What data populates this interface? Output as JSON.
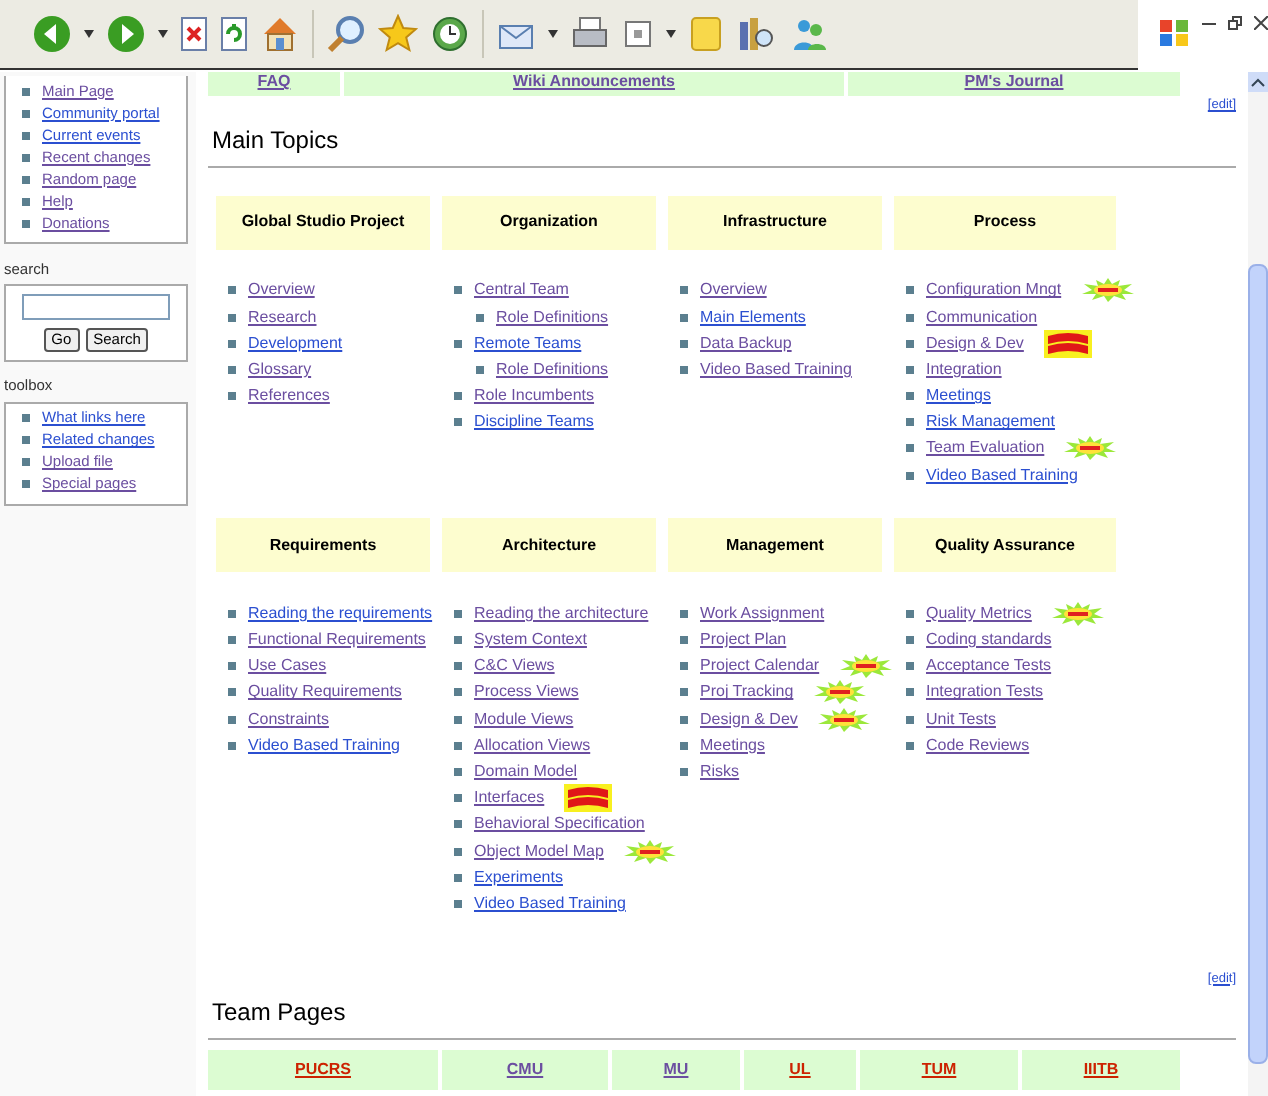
{
  "nav_links": [
    {
      "label": "FAQ",
      "visited": true
    },
    {
      "label": "Wiki Announcements",
      "visited": true
    },
    {
      "label": "PM's Journal",
      "visited": true
    }
  ],
  "sidebar": {
    "navigation": [
      {
        "label": "Main Page",
        "visited": true
      },
      {
        "label": "Community portal",
        "visited": false
      },
      {
        "label": "Current events",
        "visited": false
      },
      {
        "label": "Recent changes",
        "visited": true
      },
      {
        "label": "Random page",
        "visited": true
      },
      {
        "label": "Help",
        "visited": true
      },
      {
        "label": "Donations",
        "visited": true
      }
    ],
    "search": {
      "label": "search",
      "buttons": [
        "Go",
        "Search"
      ]
    },
    "toolbox": {
      "label": "toolbox",
      "items": [
        {
          "label": "What links here",
          "visited": false
        },
        {
          "label": "Related changes",
          "visited": false
        },
        {
          "label": "Upload file",
          "visited": true
        },
        {
          "label": "Special pages",
          "visited": true
        }
      ]
    }
  },
  "main_topics": {
    "title": "Main Topics",
    "edit": "[edit]",
    "sections": [
      {
        "title": "Global Studio Project",
        "items": [
          {
            "kind": "plain",
            "label": "Overview",
            "visited": true
          },
          {
            "kind": "plain",
            "label": "Research",
            "visited": true
          },
          {
            "kind": "plain",
            "label": "Development",
            "visited": false
          },
          {
            "kind": "plain",
            "label": "Glossary",
            "visited": true
          },
          {
            "kind": "plain",
            "label": "References",
            "visited": true
          }
        ]
      },
      {
        "title": "Organization",
        "items": [
          {
            "kind": "plain",
            "label": "Central Team",
            "visited": true,
            "children": [
              {
                "label": "Role Definitions",
                "visited": true
              }
            ]
          },
          {
            "kind": "plain",
            "label": "Remote Teams",
            "visited": false,
            "children": [
              {
                "label": "Role Definitions",
                "visited": true
              }
            ]
          },
          {
            "kind": "plain",
            "label": "Role Incumbents",
            "visited": true
          },
          {
            "kind": "plain",
            "label": "Discipline Teams",
            "visited": false
          }
        ]
      },
      {
        "title": "Infrastructure",
        "items": [
          {
            "kind": "plain",
            "label": "Overview",
            "visited": true
          },
          {
            "kind": "plain",
            "label": "Main Elements",
            "visited": false
          },
          {
            "kind": "plain",
            "label": "Data Backup",
            "visited": true
          },
          {
            "kind": "plain",
            "label": "Video Based Training",
            "visited": true
          }
        ]
      },
      {
        "title": "Process",
        "items": [
          {
            "kind": "new",
            "label": "Configuration Mngt",
            "visited": true
          },
          {
            "kind": "plain",
            "label": "Communication",
            "visited": true
          },
          {
            "kind": "updated",
            "label": "Design & Dev",
            "visited": true
          },
          {
            "kind": "plain",
            "label": "Integration",
            "visited": true
          },
          {
            "kind": "plain",
            "label": "Meetings",
            "visited": false
          },
          {
            "kind": "plain",
            "label": "Risk Management",
            "visited": false
          },
          {
            "kind": "new",
            "label": "Team Evaluation",
            "visited": true
          },
          {
            "kind": "plain",
            "label": "Video Based Training",
            "visited": false
          }
        ]
      },
      {
        "title": "Requirements",
        "items": [
          {
            "kind": "plain",
            "label": "Reading the requirements",
            "visited": false
          },
          {
            "kind": "plain",
            "label": "Functional Requirements",
            "visited": true
          },
          {
            "kind": "plain",
            "label": "Use Cases",
            "visited": true
          },
          {
            "kind": "plain",
            "label": "Quality Requirements",
            "visited": true
          },
          {
            "kind": "plain",
            "label": "Constraints",
            "visited": true
          },
          {
            "kind": "plain",
            "label": "Video Based Training",
            "visited": false
          }
        ]
      },
      {
        "title": "Architecture",
        "items": [
          {
            "kind": "plain",
            "label": "Reading the architecture",
            "visited": true
          },
          {
            "kind": "plain",
            "label": "System Context",
            "visited": true
          },
          {
            "kind": "plain",
            "label": "C&C Views",
            "visited": true
          },
          {
            "kind": "plain",
            "label": "Process Views",
            "visited": true
          },
          {
            "kind": "plain",
            "label": "Module Views",
            "visited": true
          },
          {
            "kind": "plain",
            "label": "Allocation Views",
            "visited": true
          },
          {
            "kind": "plain",
            "label": "Domain Model",
            "visited": true
          },
          {
            "kind": "updated",
            "label": "Interfaces",
            "visited": true
          },
          {
            "kind": "plain",
            "label": "Behavioral Specification",
            "visited": true
          },
          {
            "kind": "new",
            "label": "Object Model Map",
            "visited": true
          },
          {
            "kind": "plain",
            "label": "Experiments",
            "visited": false
          },
          {
            "kind": "plain",
            "label": "Video Based Training",
            "visited": false
          }
        ]
      },
      {
        "title": "Management",
        "items": [
          {
            "kind": "plain",
            "label": "Work Assignment",
            "visited": true
          },
          {
            "kind": "plain",
            "label": "Project Plan",
            "visited": true
          },
          {
            "kind": "new",
            "label": "Project Calendar",
            "visited": true
          },
          {
            "kind": "new",
            "label": "Proj Tracking",
            "visited": true
          },
          {
            "kind": "new",
            "label": "Design & Dev",
            "visited": true
          },
          {
            "kind": "plain",
            "label": "Meetings",
            "visited": true
          },
          {
            "kind": "plain",
            "label": "Risks",
            "visited": true
          }
        ]
      },
      {
        "title": "Quality Assurance",
        "items": [
          {
            "kind": "new",
            "label": "Quality Metrics",
            "visited": true
          },
          {
            "kind": "plain",
            "label": "Coding standards",
            "visited": true
          },
          {
            "kind": "plain",
            "label": "Acceptance Tests",
            "visited": true
          },
          {
            "kind": "plain",
            "label": "Integration Tests",
            "visited": true
          },
          {
            "kind": "plain",
            "label": "Unit Tests",
            "visited": true
          },
          {
            "kind": "plain",
            "label": "Code Reviews",
            "visited": true
          }
        ]
      }
    ]
  },
  "team_pages": {
    "title": "Team Pages",
    "edit": "[edit]",
    "teams": [
      {
        "label": "PUCRS",
        "exists": false
      },
      {
        "label": "CMU",
        "exists": true
      },
      {
        "label": "MU",
        "exists": true
      },
      {
        "label": "UL",
        "exists": false
      },
      {
        "label": "TUM",
        "exists": false
      },
      {
        "label": "IIITB",
        "exists": false
      }
    ]
  }
}
